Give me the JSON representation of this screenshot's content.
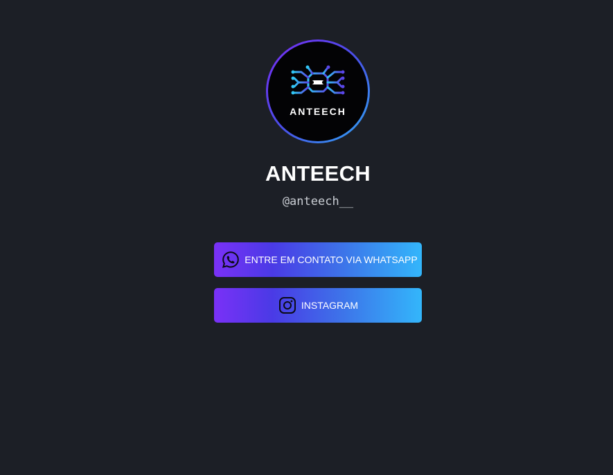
{
  "profile": {
    "avatar_logo_text": "ANTEECH",
    "name": "ANTEECH",
    "handle": "@anteech__"
  },
  "links": [
    {
      "label": "ENTRE EM CONTATO VIA WHATSAPP",
      "icon": "whatsapp-icon"
    },
    {
      "label": "INSTAGRAM",
      "icon": "instagram-icon"
    }
  ],
  "colors": {
    "background": "#1c1f26",
    "button_gradient_start": "#7a31f7",
    "button_gradient_mid": "#4a3ae6",
    "button_gradient_end": "#33b6fb",
    "avatar_ring_start": "#7a2cf5",
    "avatar_ring_end": "#2fa8f4",
    "text_primary": "#ffffff",
    "text_secondary": "#c9cdd3"
  }
}
